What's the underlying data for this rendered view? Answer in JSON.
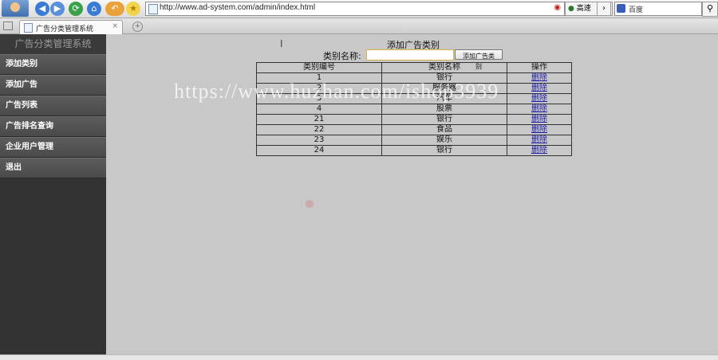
{
  "browser": {
    "url": "http://www.ad-system.com/admin/index.html",
    "go_label": "高速",
    "search_placeholder": "百度",
    "tab_title": "广告分类管理系统",
    "tab_close": "×",
    "icons": [
      "back-icon",
      "forward-icon",
      "refresh-icon",
      "home-icon",
      "undo-icon",
      "favorite-star-icon",
      "search-icon"
    ]
  },
  "sidebar": {
    "title": "广告分类管理系统",
    "items": [
      {
        "label": "添加类别"
      },
      {
        "label": "添加广告"
      },
      {
        "label": "广告列表"
      },
      {
        "label": "广告排名查询"
      },
      {
        "label": "企业用户管理"
      },
      {
        "label": "退出"
      }
    ]
  },
  "main": {
    "page_title": "添加广告类别",
    "form": {
      "label": "类别名称:",
      "input_value": "",
      "submit_label": "添加广告类别"
    },
    "table": {
      "headers": [
        "类别编号",
        "类别名称",
        "操作"
      ],
      "rows": [
        {
          "id": "1",
          "name": "银行",
          "action": "删除"
        },
        {
          "id": "2",
          "name": "服务器",
          "action": "删除"
        },
        {
          "id": "3",
          "name": "汽车",
          "action": "删除"
        },
        {
          "id": "4",
          "name": "股票",
          "action": "删除"
        },
        {
          "id": "21",
          "name": "银行",
          "action": "删除"
        },
        {
          "id": "22",
          "name": "食品",
          "action": "删除"
        },
        {
          "id": "23",
          "name": "娱乐",
          "action": "删除"
        },
        {
          "id": "24",
          "name": "银行",
          "action": "删除"
        }
      ]
    },
    "watermark": "https://www.huzhan.com/ishop3939"
  }
}
